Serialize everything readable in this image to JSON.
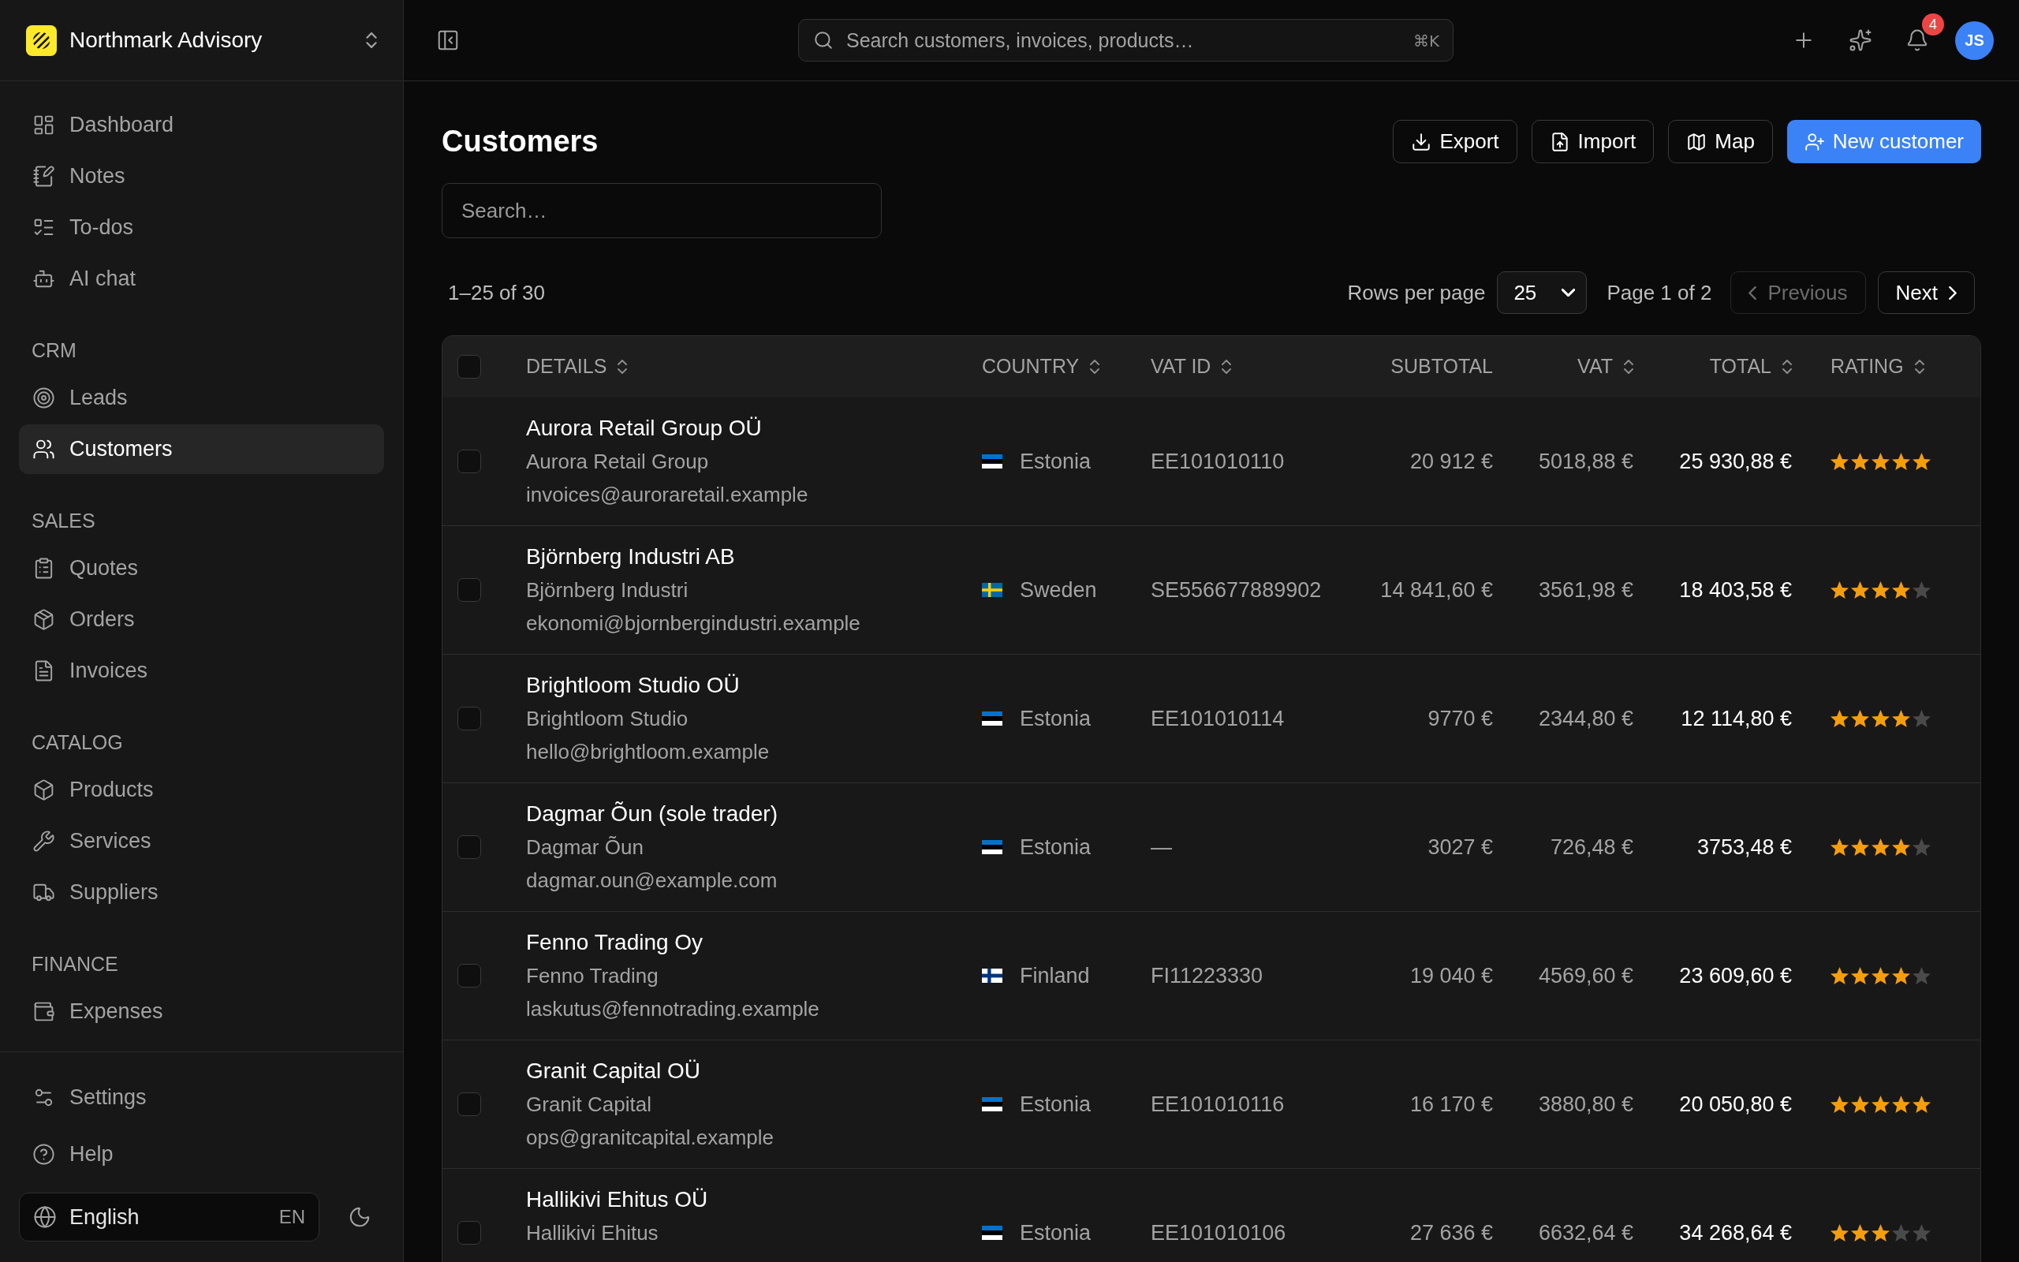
{
  "sidebar": {
    "brand": {
      "name": "Northmark Advisory"
    },
    "nav": [
      {
        "label": "Dashboard",
        "kind": "dashboard",
        "selected": false
      },
      {
        "label": "Notes",
        "kind": "notes",
        "selected": false
      },
      {
        "label": "To-dos",
        "kind": "todos",
        "selected": false
      },
      {
        "label": "AI chat",
        "kind": "chat",
        "selected": false
      }
    ],
    "sections": [
      {
        "title": "CRM",
        "items": [
          {
            "label": "Leads",
            "kind": "leads",
            "selected": false
          },
          {
            "label": "Customers",
            "kind": "customers",
            "selected": true
          }
        ]
      },
      {
        "title": "SALES",
        "items": [
          {
            "label": "Quotes",
            "kind": "quotes",
            "selected": false
          },
          {
            "label": "Orders",
            "kind": "orders",
            "selected": false
          },
          {
            "label": "Invoices",
            "kind": "invoices",
            "selected": false
          }
        ]
      },
      {
        "title": "CATALOG",
        "items": [
          {
            "label": "Products",
            "kind": "products",
            "selected": false
          },
          {
            "label": "Services",
            "kind": "services",
            "selected": false
          },
          {
            "label": "Suppliers",
            "kind": "suppliers",
            "selected": false
          }
        ]
      },
      {
        "title": "FINANCE",
        "items": [
          {
            "label": "Expenses",
            "kind": "expenses",
            "selected": false
          }
        ]
      }
    ],
    "footer": [
      {
        "label": "Settings",
        "kind": "settings",
        "selected": false
      },
      {
        "label": "Help",
        "kind": "help",
        "selected": false
      }
    ],
    "language": {
      "label": "English",
      "code": "EN"
    }
  },
  "topbar": {
    "search": {
      "placeholder": "Search customers, invoices, products…",
      "shortcut": "⌘K"
    },
    "notifications": {
      "count": "4"
    },
    "avatar": {
      "initials": "JS"
    }
  },
  "page": {
    "title": "Customers",
    "actions": [
      {
        "label": "Export",
        "kind": "export"
      },
      {
        "label": "Import",
        "kind": "import"
      },
      {
        "label": "Map",
        "kind": "map"
      },
      {
        "label": "New customer",
        "kind": "create"
      }
    ],
    "search": {
      "placeholder": "Search…"
    }
  },
  "pagination": {
    "range": "1–25 of 30",
    "rows_per_page_label": "Rows per page",
    "rows_per_page": "25",
    "page": "Page 1 of 2",
    "previous": {
      "label": "Previous",
      "disabled": true
    },
    "next": {
      "label": "Next",
      "disabled": false
    }
  },
  "table": {
    "select_all": {
      "checked": false
    },
    "columns": [
      {
        "label": "DETAILS",
        "sortable": true
      },
      {
        "label": "COUNTRY",
        "sortable": true
      },
      {
        "label": "VAT ID",
        "sortable": true
      },
      {
        "label": "SUBTOTAL",
        "sortable": false
      },
      {
        "label": "VAT",
        "sortable": true
      },
      {
        "label": "TOTAL",
        "sortable": true
      },
      {
        "label": "RATING",
        "sortable": true
      }
    ],
    "rows": [
      {
        "checked": false,
        "name": "Aurora Retail Group OÜ",
        "company": "Aurora Retail Group",
        "email": "invoices@auroraretail.example",
        "country": {
          "name": "Estonia",
          "kind": "estonia"
        },
        "vat_id": "EE101010110",
        "subtotal": "20 912 €",
        "vat": "5018,88 €",
        "total": "25 930,88 €",
        "stars": 5
      },
      {
        "checked": false,
        "name": "Björnberg Industri AB",
        "company": "Björnberg Industri",
        "email": "ekonomi@bjornbergindustri.example",
        "country": {
          "name": "Sweden",
          "kind": "sweden"
        },
        "vat_id": "SE556677889902",
        "subtotal": "14 841,60 €",
        "vat": "3561,98 €",
        "total": "18 403,58 €",
        "stars": 4
      },
      {
        "checked": false,
        "name": "Brightloom Studio OÜ",
        "company": "Brightloom Studio",
        "email": "hello@brightloom.example",
        "country": {
          "name": "Estonia",
          "kind": "estonia"
        },
        "vat_id": "EE101010114",
        "subtotal": "9770 €",
        "vat": "2344,80 €",
        "total": "12 114,80 €",
        "stars": 4
      },
      {
        "checked": false,
        "name": "Dagmar Õun (sole trader)",
        "company": "Dagmar Õun",
        "email": "dagmar.oun@example.com",
        "country": {
          "name": "Estonia",
          "kind": "estonia"
        },
        "vat_id": "—",
        "subtotal": "3027 €",
        "vat": "726,48 €",
        "total": "3753,48 €",
        "stars": 4
      },
      {
        "checked": false,
        "name": "Fenno Trading Oy",
        "company": "Fenno Trading",
        "email": "laskutus@fennotrading.example",
        "country": {
          "name": "Finland",
          "kind": "finland"
        },
        "vat_id": "FI11223330",
        "subtotal": "19 040 €",
        "vat": "4569,60 €",
        "total": "23 609,60 €",
        "stars": 4
      },
      {
        "checked": false,
        "name": "Granit Capital OÜ",
        "company": "Granit Capital",
        "email": "ops@granitcapital.example",
        "country": {
          "name": "Estonia",
          "kind": "estonia"
        },
        "vat_id": "EE101010116",
        "subtotal": "16 170 €",
        "vat": "3880,80 €",
        "total": "20 050,80 €",
        "stars": 5
      },
      {
        "checked": false,
        "name": "Hallikivi Ehitus OÜ",
        "company": "Hallikivi Ehitus",
        "country": {
          "name": "Estonia",
          "kind": "estonia"
        },
        "vat_id": "EE101010106",
        "subtotal": "27 636 €",
        "vat": "6632,64 €",
        "total": "34 268,64 €",
        "stars": 3
      }
    ]
  }
}
